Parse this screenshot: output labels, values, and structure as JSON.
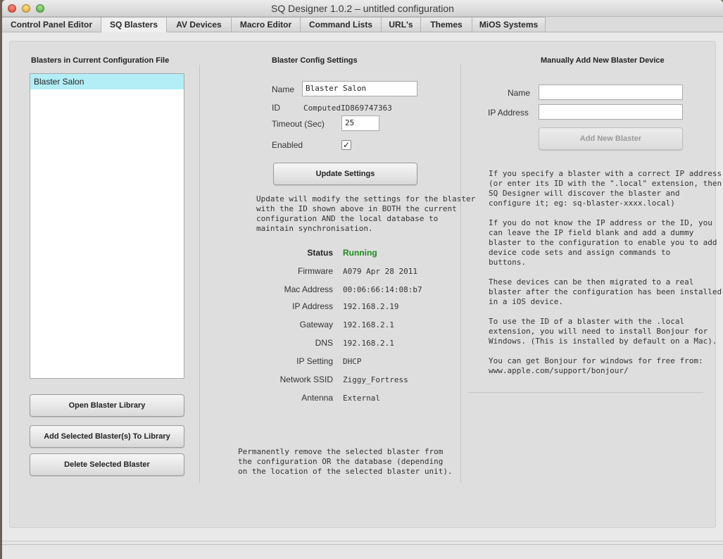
{
  "window": {
    "title": "SQ Designer 1.0.2 – untitled configuration"
  },
  "tabs": [
    {
      "label": "Control Panel Editor"
    },
    {
      "label": "SQ Blasters"
    },
    {
      "label": "AV Devices"
    },
    {
      "label": "Macro Editor"
    },
    {
      "label": "Command Lists"
    },
    {
      "label": "URL's"
    },
    {
      "label": "Themes"
    },
    {
      "label": "MiOS Systems"
    }
  ],
  "active_tab": "SQ Blasters",
  "left": {
    "title": "Blasters in Current Configuration File",
    "items": [
      "Blaster Salon"
    ],
    "open_library": "Open Blaster Library",
    "add_to_library": "Add Selected Blaster(s) To Library",
    "delete": "Delete Selected Blaster"
  },
  "config": {
    "title": "Blaster Config Settings",
    "name_label": "Name",
    "name_value": "Blaster Salon",
    "id_label": "ID",
    "id_value": "ComputedID869747363",
    "timeout_label": "Timeout (Sec)",
    "timeout_value": "25",
    "enabled_label": "Enabled",
    "enabled": true,
    "enabled_mark": "✓",
    "update_button": "Update Settings",
    "update_note": "Update will modify the settings for the blaster\nwith the ID shown above in BOTH the current\nconfiguration AND the local database to\nmaintain synchronisation.",
    "status": [
      {
        "label": "Status",
        "value": "Running"
      },
      {
        "label": "Firmware",
        "value": "A079  Apr 28 2011"
      },
      {
        "label": "Mac Address",
        "value": "00:06:66:14:08:b7"
      },
      {
        "label": "IP Address",
        "value": "192.168.2.19"
      },
      {
        "label": "Gateway",
        "value": "192.168.2.1"
      },
      {
        "label": "DNS",
        "value": "192.168.2.1"
      },
      {
        "label": "IP Setting",
        "value": "DHCP"
      },
      {
        "label": "Network SSID",
        "value": "Ziggy_Fortress"
      },
      {
        "label": "Antenna",
        "value": "External"
      }
    ],
    "delete_note": "Permanently remove the selected blaster from\nthe configuration OR the database (depending\non the location of the selected blaster unit)."
  },
  "manual": {
    "title": "Manually Add New Blaster Device",
    "name_label": "Name",
    "name_value": "",
    "ip_label": "IP Address",
    "ip_value": "",
    "add_button": "Add New Blaster",
    "help1": "If you specify a blaster with a correct IP address\n(or enter its ID with the \".local\" extension, then\nSQ Designer will discover the blaster and\nconfigure it; eg: sq-blaster-xxxx.local)",
    "help2": "If you do not know the IP address or the ID, you\ncan leave the IP field blank and add a dummy\nblaster to the configuration to enable you to add\ndevice code sets and assign commands to\nbuttons.",
    "help3": "These devices can be then migrated to a real\nblaster after the configuration has been installed\nin a iOS device.",
    "help4": "To use the ID of a blaster with the .local\nextension, you will need to install Bonjour for\nWindows. (This is installed by default on a Mac).",
    "help5": "You can get Bonjour for windows for free from:\nwww.apple.com/support/bonjour/"
  },
  "colors": {
    "selection": "#b3eef7",
    "status_running": "#1a8a1a"
  }
}
